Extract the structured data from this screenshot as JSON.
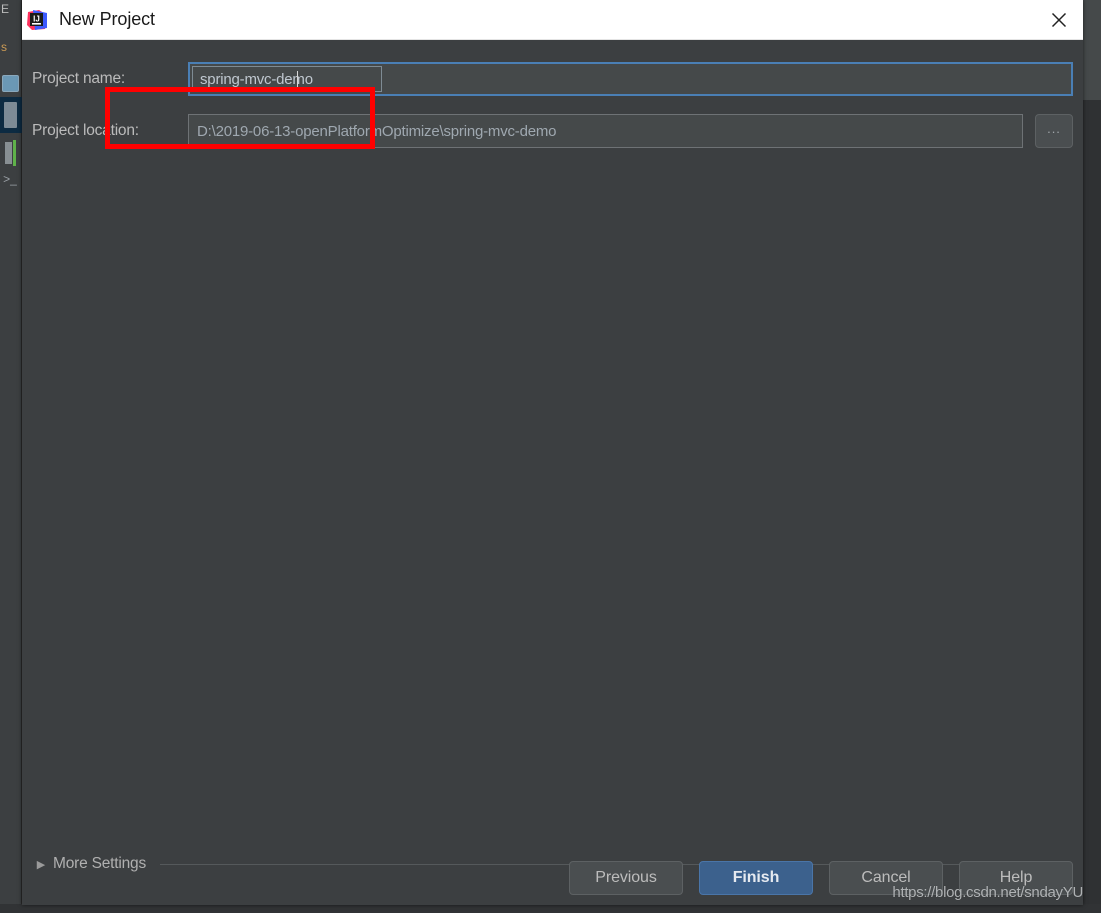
{
  "window": {
    "title": "New Project",
    "app_icon": "intellij-idea-logo",
    "close_icon": "close-icon"
  },
  "background_ide": {
    "menu_text": "E",
    "tab_text": "s",
    "icons": [
      "editor-icon",
      "project-icon",
      "run-icon",
      "terminal-icon"
    ]
  },
  "form": {
    "project_name": {
      "label": "Project name:",
      "value": "spring-mvc-demo",
      "placeholder": "",
      "focused": true
    },
    "project_location": {
      "label": "Project location:",
      "value": "D:\\2019-06-13-openPlatformOptimize\\spring-mvc-demo",
      "placeholder": "",
      "browse_label": "..."
    }
  },
  "more_settings": {
    "label": "More Settings",
    "arrow_icon": "chevron-right-icon",
    "expanded": false
  },
  "buttons": {
    "previous": "Previous",
    "finish": "Finish",
    "cancel": "Cancel",
    "help": "Help"
  },
  "annotation": {
    "type": "red-rectangle-highlight",
    "color": "#ff0000",
    "target": "project-name-field"
  },
  "watermark": {
    "text": "https://blog.csdn.net/sndayYU"
  },
  "colors": {
    "dialog_background": "#3c3f41",
    "field_background": "#45494a",
    "focus_border": "#4a7fb5",
    "primary_button": "#3c618d",
    "titlebar_background": "#ffffff",
    "text_primary": "#bbbbbb",
    "annotation": "#ff0000"
  }
}
